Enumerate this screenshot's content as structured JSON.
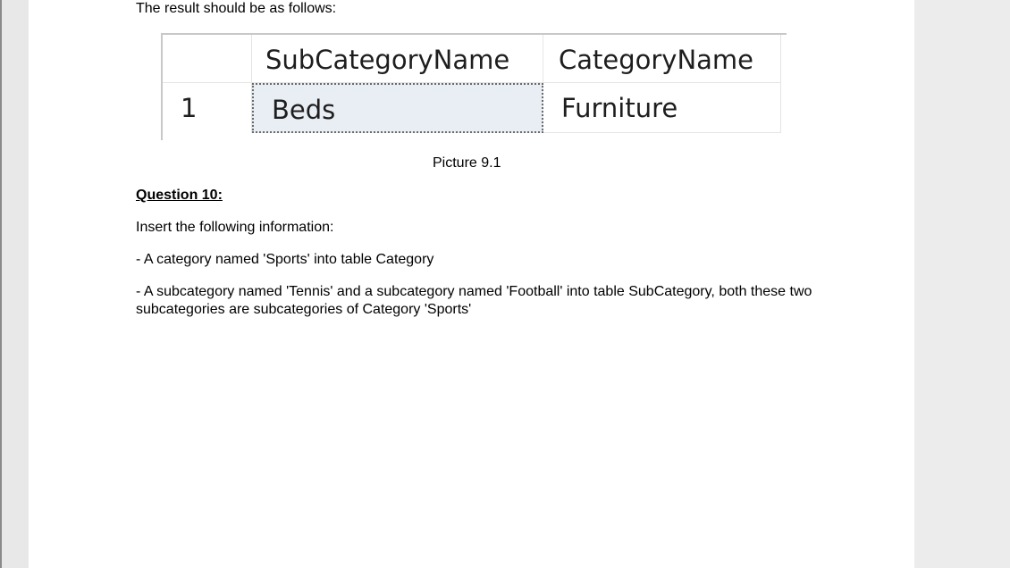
{
  "document": {
    "intro": "The result should be as follows:",
    "result_grid": {
      "headers": [
        "",
        "SubCategoryName",
        "CategoryName"
      ],
      "rows": [
        {
          "row_number": "1",
          "cells": [
            "Beds",
            "Furniture"
          ]
        }
      ]
    },
    "caption": "Picture 9.1",
    "question_heading": "Question 10:",
    "instruction": "Insert the following information:",
    "bullets": [
      "- A category named 'Sports' into table Category",
      "- A subcategory named 'Tennis' and a subcategory named 'Football' into table SubCategory, both these two subcategories are subcategories of Category 'Sports'"
    ]
  }
}
